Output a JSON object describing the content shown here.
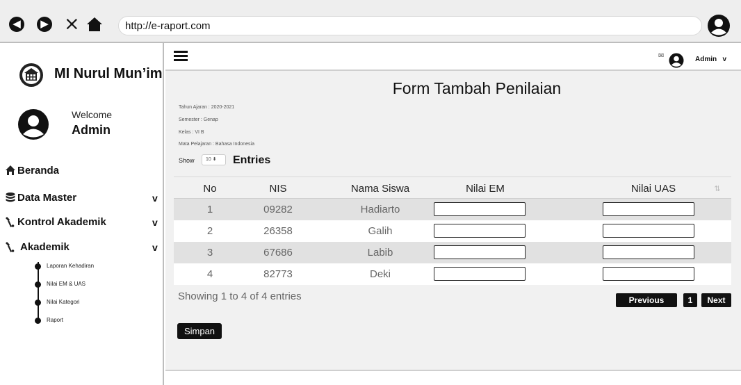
{
  "browser": {
    "url": "http://e-raport.com",
    "back_glyph": "◀",
    "forward_glyph": "▶",
    "close_glyph": "×"
  },
  "sidebar": {
    "brand": "MI Nurul Mun’im",
    "welcome": "Welcome",
    "username": "Admin",
    "menu": [
      {
        "label": "Beranda",
        "icon": "home-icon",
        "chevron": ""
      },
      {
        "label": "Data Master",
        "icon": "database-icon",
        "chevron": "v"
      },
      {
        "label": "Kontrol Akademik",
        "icon": "tools-icon",
        "chevron": "v"
      },
      {
        "label": "Akademik",
        "icon": "tools-icon",
        "chevron": "v"
      }
    ],
    "submenu": [
      {
        "label": "Laporan Kehadiran"
      },
      {
        "label": "Nilai EM & UAS"
      },
      {
        "label": "Nilai Kategori"
      },
      {
        "label": "Raport"
      }
    ]
  },
  "topbar": {
    "mail_glyph": "✉",
    "user": "Admin",
    "chevron": "v"
  },
  "form": {
    "title": "Form Tambah Penilaian",
    "info": [
      "Tahun Ajaran : 2020-2021",
      "Semester : Genap",
      "Kelas : VI B",
      "Mata Pelajaran : Bahasa Indonesia"
    ],
    "show_label": "Show",
    "show_value": "10 ⬍",
    "entries_label": "Entries",
    "sort_glyph": "⇅",
    "columns": [
      "No",
      "NIS",
      "Nama Siswa",
      "Nilai EM",
      "Nilai UAS"
    ],
    "rows": [
      {
        "no": "1",
        "nis": "09282",
        "nama": "Hadiarto"
      },
      {
        "no": "2",
        "nis": "26358",
        "nama": "Galih"
      },
      {
        "no": "3",
        "nis": "67686",
        "nama": "Labib"
      },
      {
        "no": "4",
        "nis": "82773",
        "nama": "Deki"
      }
    ],
    "showing": "Showing 1 to 4 of 4 entries",
    "previous": "Previous",
    "page": "1",
    "next": "Next",
    "save": "Simpan"
  },
  "colors": {
    "accent": "#111111",
    "row_alt": "#e1e1e1",
    "content_bg": "#f1f1f1"
  }
}
